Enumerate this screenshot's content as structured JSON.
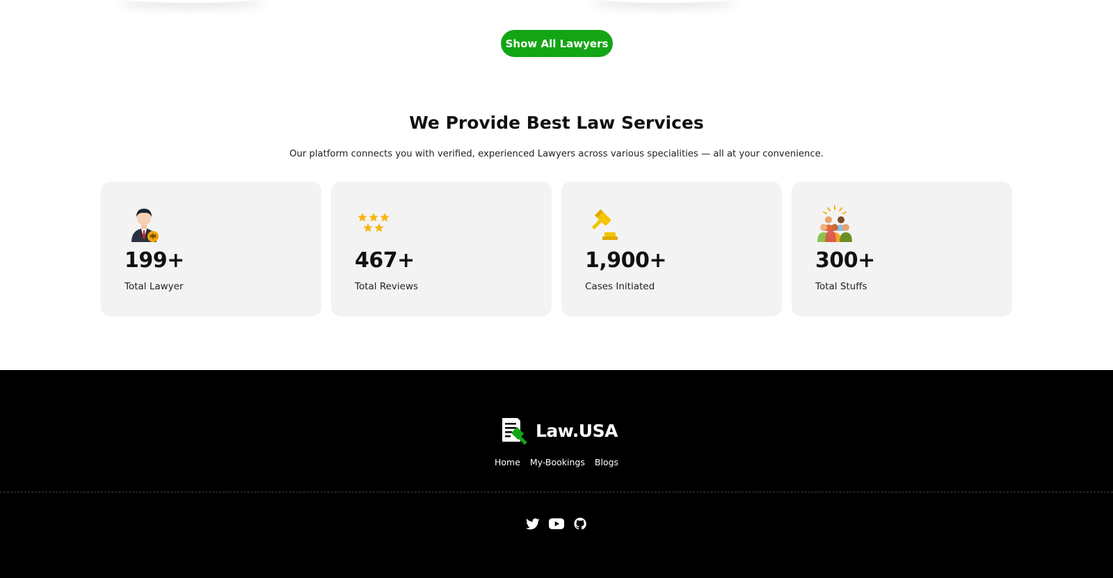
{
  "actions": {
    "show_all_label": "Show All Lawyers"
  },
  "services": {
    "title": "We Provide Best Law Services",
    "subtitle": "Our platform connects you with verified, experienced Lawyers across various specialities — all at your convenience."
  },
  "stats": [
    {
      "icon": "lawyer-icon",
      "value": "199+",
      "label": "Total Lawyer"
    },
    {
      "icon": "stars-icon",
      "value": "467+",
      "label": "Total Reviews"
    },
    {
      "icon": "gavel-icon",
      "value": "1,900+",
      "label": "Cases Initiated"
    },
    {
      "icon": "team-icon",
      "value": "300+",
      "label": "Total Stuffs"
    }
  ],
  "footer": {
    "brand": "Law.USA",
    "nav": [
      "Home",
      "My-Bookings",
      "Blogs"
    ],
    "socials": [
      "twitter-icon",
      "youtube-icon",
      "github-icon"
    ]
  },
  "colors": {
    "accent": "#14a515",
    "footer_bg": "#000000",
    "card_bg": "#f3f3f3"
  }
}
